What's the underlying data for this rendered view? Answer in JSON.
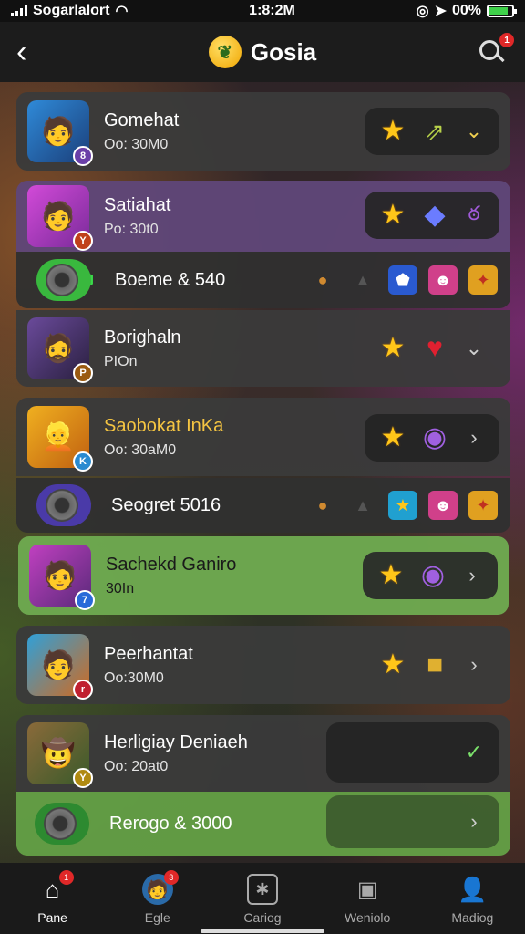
{
  "status_bar": {
    "carrier": "Sogarlalort",
    "time": "1:8:2M",
    "battery": "00%"
  },
  "header": {
    "back_icon": "chevron-left-icon",
    "title": "Gosia",
    "logo_icon": "leaf-logo-icon",
    "search_badge": "1"
  },
  "rows": [
    {
      "name": "Gomehat",
      "sub": "Oo: 30M0"
    },
    {
      "name": "Satiahat",
      "sub": "Po: 30t0"
    },
    {
      "name": "Boeme & 540"
    },
    {
      "name": "Borighaln",
      "sub": "PIOn"
    },
    {
      "name": "Saobokat InKa",
      "sub": "Oo: 30aM0"
    },
    {
      "name": "Seogret 5016"
    },
    {
      "name": "Sachekd Ganiro",
      "sub": "30In"
    },
    {
      "name": "Peerhantat",
      "sub": "Oo:30M0"
    },
    {
      "name": "Herligiay Deniaeh",
      "sub": "Oo: 20at0"
    },
    {
      "name": "Rerogo & 3000"
    }
  ],
  "badges": [
    "8",
    "Y",
    "P",
    "K",
    "7",
    "r",
    "Y"
  ],
  "tabs": [
    {
      "label": "Pane",
      "icon": "home-icon",
      "badge": "1"
    },
    {
      "label": "Egle",
      "icon": "avatar-icon",
      "badge": "3"
    },
    {
      "label": "Cariog",
      "icon": "star-box-icon"
    },
    {
      "label": "Weniolo",
      "icon": "device-icon"
    },
    {
      "label": "Madiog",
      "icon": "profile-icon"
    }
  ],
  "colors": {
    "accent_green": "#6eaa50",
    "accent_purple": "#5f4678",
    "star_gold": "#ffc619"
  }
}
